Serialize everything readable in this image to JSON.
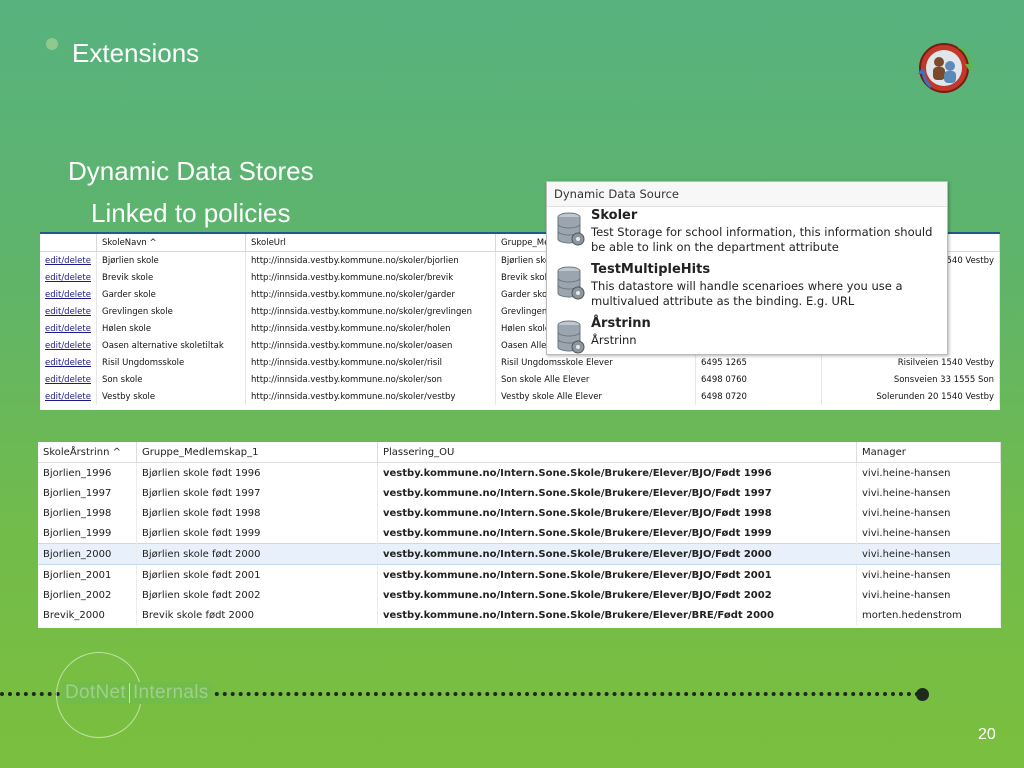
{
  "slide": {
    "title": "Extensions",
    "subtitle1": "Dynamic Data Stores",
    "subtitle2": "Linked to policies",
    "page_number": "20",
    "brand": {
      "part1": "DotNet",
      "part2": "Internals"
    }
  },
  "table1": {
    "headers": [
      "",
      "SkoleNavn",
      "SkoleUrl",
      "Gruppe_Med",
      "",
      ""
    ],
    "sort_indicator": "^",
    "action_label": "edit/delete",
    "rows": [
      {
        "name": "Bjørlien skole",
        "url": "http://innsida.vestby.kommune.no/skoler/bjorlien",
        "gruppe": "Bjørlien skol",
        "phone": "",
        "address": "1540 Vestby"
      },
      {
        "name": "Brevik skole",
        "url": "http://innsida.vestby.kommune.no/skoler/brevik",
        "gruppe": "Brevik skole /",
        "phone": "",
        "address": ""
      },
      {
        "name": "Garder skole",
        "url": "http://innsida.vestby.kommune.no/skoler/garder",
        "gruppe": "Garder skole",
        "phone": "",
        "address": ""
      },
      {
        "name": "Grevlingen skole",
        "url": "http://innsida.vestby.kommune.no/skoler/grevlingen",
        "gruppe": "Grevlingen sk",
        "phone": "",
        "address": ""
      },
      {
        "name": "Hølen skole",
        "url": "http://innsida.vestby.kommune.no/skoler/holen",
        "gruppe": "Hølen skole /",
        "phone": "",
        "address": ""
      },
      {
        "name": "Oasen alternative skoletiltak",
        "url": "http://innsida.vestby.kommune.no/skoler/oasen",
        "gruppe": "Oasen Alle El",
        "phone": "",
        "address": ""
      },
      {
        "name": "Risil Ungdomsskole",
        "url": "http://innsida.vestby.kommune.no/skoler/risil",
        "gruppe": "Risil Ungdomsskole Elever",
        "phone": "6495 1265",
        "address": "Risilveien 1540 Vestby"
      },
      {
        "name": "Son skole",
        "url": "http://innsida.vestby.kommune.no/skoler/son",
        "gruppe": "Son skole Alle Elever",
        "phone": "6498 0760",
        "address": "Sonsveien 33 1555 Son"
      },
      {
        "name": "Vestby skole",
        "url": "http://innsida.vestby.kommune.no/skoler/vestby",
        "gruppe": "Vestby skole Alle Elever",
        "phone": "6498 0720",
        "address": "Solerunden 20 1540 Vestby"
      }
    ]
  },
  "popup": {
    "title": "Dynamic Data Source",
    "items": [
      {
        "name": "Skoler",
        "desc": "Test Storage for school information, this information should be able to link on the department attribute",
        "icon": "database-icon"
      },
      {
        "name": "TestMultipleHits",
        "desc": "This datastore will handle scenarioes where you use a multivalued attribute as the binding. E.g. URL",
        "icon": "database-icon"
      },
      {
        "name": "Årstrinn",
        "desc": "Årstrinn",
        "icon": "database-icon"
      }
    ]
  },
  "table2": {
    "headers": [
      "SkoleÅrstrinn",
      "Gruppe_Medlemskap_1",
      "Plassering_OU",
      "Manager"
    ],
    "sort_indicator": "^",
    "selected_row": 4,
    "rows": [
      {
        "skole": "Bjorlien_1996",
        "gruppe": "Bjørlien skole født 1996",
        "ou": "vestby.kommune.no/Intern.Sone.Skole/Brukere/Elever/BJO/Født 1996",
        "manager": "vivi.heine-hansen"
      },
      {
        "skole": "Bjorlien_1997",
        "gruppe": "Bjørlien skole født 1997",
        "ou": "vestby.kommune.no/Intern.Sone.Skole/Brukere/Elever/BJO/Født 1997",
        "manager": "vivi.heine-hansen"
      },
      {
        "skole": "Bjorlien_1998",
        "gruppe": "Bjørlien skole født 1998",
        "ou": "vestby.kommune.no/Intern.Sone.Skole/Brukere/Elever/BJO/Født 1998",
        "manager": "vivi.heine-hansen"
      },
      {
        "skole": "Bjorlien_1999",
        "gruppe": "Bjørlien skole født 1999",
        "ou": "vestby.kommune.no/Intern.Sone.Skole/Brukere/Elever/BJO/Født 1999",
        "manager": "vivi.heine-hansen"
      },
      {
        "skole": "Bjorlien_2000",
        "gruppe": "Bjørlien skole født 2000",
        "ou": "vestby.kommune.no/Intern.Sone.Skole/Brukere/Elever/BJO/Født 2000",
        "manager": "vivi.heine-hansen"
      },
      {
        "skole": "Bjorlien_2001",
        "gruppe": "Bjørlien skole født 2001",
        "ou": "vestby.kommune.no/Intern.Sone.Skole/Brukere/Elever/BJO/Født 2001",
        "manager": "vivi.heine-hansen"
      },
      {
        "skole": "Bjorlien_2002",
        "gruppe": "Bjørlien skole født 2002",
        "ou": "vestby.kommune.no/Intern.Sone.Skole/Brukere/Elever/BJO/Født 2002",
        "manager": "vivi.heine-hansen"
      },
      {
        "skole": "Brevik_2000",
        "gruppe": "Brevik skole født 2000",
        "ou": "vestby.kommune.no/Intern.Sone.Skole/Brukere/Elever/BRE/Født 2000",
        "manager": "morten.hedenstrom"
      }
    ]
  },
  "colors": {
    "header_border": "#1e5a8c",
    "link": "#1a1a8a",
    "selected_row": "#e8f1fb"
  }
}
